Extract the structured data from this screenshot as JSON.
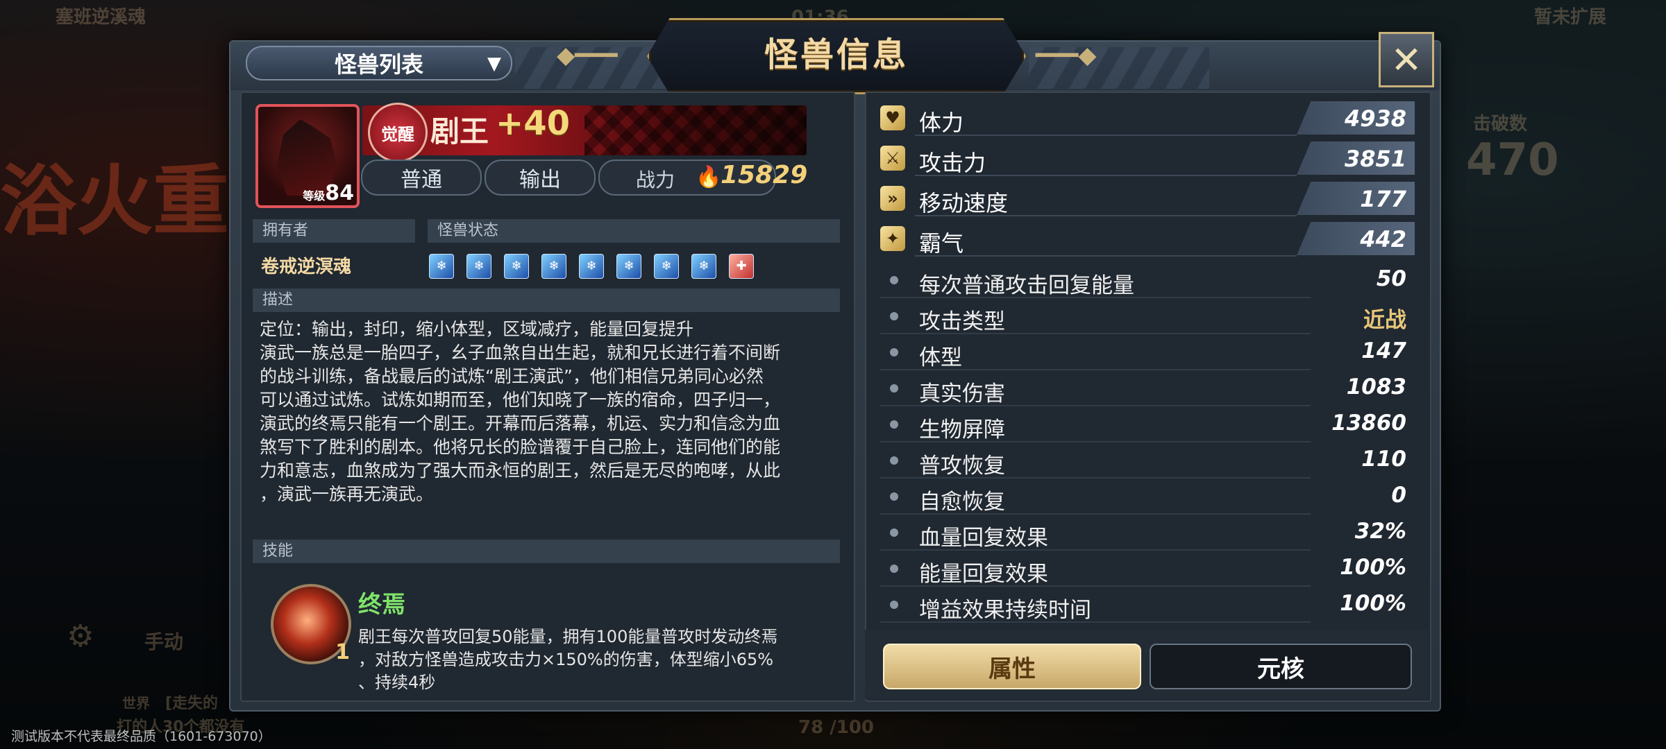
{
  "background": {
    "top_left_label": "塞班逆溪魂",
    "top_center": "01:36",
    "top_right_label": "暂未扩展",
    "left_banner": "浴火重",
    "right_badge_label": "击破数",
    "right_badge_value": "470",
    "bottom_left_setting": "手动",
    "bottom_chat_tag": "世界",
    "bottom_chat_line1": "[走失的",
    "bottom_chat_line2": "打的人30个都没有",
    "bottom_counter": "78 /100",
    "watermark": "测试版本不代表最终品质（1601-673070）"
  },
  "modal": {
    "title": "怪兽信息",
    "dropdown_label": "怪兽列表",
    "dropdown_caret": "▼",
    "close_icon": "✕"
  },
  "monster": {
    "level_label": "等级",
    "level": "84",
    "awaken_badge": "觉醒",
    "name": "剧王",
    "plus_level": "+40",
    "tags": [
      "普通",
      "输出"
    ],
    "power_label": "战力",
    "power_value": "15829"
  },
  "owner": {
    "section_label": "拥有者",
    "name": "卷戒逆溟魂"
  },
  "status": {
    "section_label": "怪兽状态",
    "icons": [
      "frost-icon",
      "frost-icon",
      "frost-icon",
      "frost-icon",
      "frost-icon",
      "frost-icon",
      "frost-icon",
      "frost-icon",
      "heal-icon"
    ]
  },
  "description": {
    "section_label": "描述",
    "role_line": "定位：输出，封印，缩小体型，区域减疗，能量回复提升",
    "lines": [
      "演武一族总是一胎四子，幺子血煞自出生起，就和兄长进行着不间断",
      "的战斗训练，备战最后的试炼“剧王演武”，他们相信兄弟同心必然",
      "可以通过试炼。试炼如期而至，他们知晓了一族的宿命，四子归一，",
      "演武的终焉只能有一个剧王。开幕而后落幕，机运、实力和信念为血",
      "煞写下了胜利的剧本。他将兄长的脸谱覆于自己脸上，连同他们的能",
      "力和意志，血煞成为了强大而永恒的剧王，然后是无尽的咆哮，从此",
      "，演武一族再无演武。"
    ]
  },
  "skill": {
    "section_label": "技能",
    "level": "1",
    "name": "终焉",
    "desc_lines": [
      "剧王每次普攻回复50能量，拥有100能量普攻时发动终焉",
      "，对敌方怪兽造成攻击力×150%的伤害，体型缩小65%",
      "、持续4秒"
    ]
  },
  "main_stats": [
    {
      "icon": "heart-icon",
      "glyph": "♥",
      "label": "体力",
      "value": "4938"
    },
    {
      "icon": "sword-icon",
      "glyph": "⚔",
      "label": "攻击力",
      "value": "3851"
    },
    {
      "icon": "speed-icon",
      "glyph": "»",
      "label": "移动速度",
      "value": "177"
    },
    {
      "icon": "claw-icon",
      "glyph": "✦",
      "label": "霸气",
      "value": "442"
    }
  ],
  "sub_stats": [
    {
      "label": "每次普通攻击回复能量",
      "value": "50"
    },
    {
      "label": "攻击类型",
      "value": "近战"
    },
    {
      "label": "体型",
      "value": "147"
    },
    {
      "label": "真实伤害",
      "value": "1083"
    },
    {
      "label": "生物屏障",
      "value": "13860"
    },
    {
      "label": "普攻恢复",
      "value": "110"
    },
    {
      "label": "自愈恢复",
      "value": "0"
    },
    {
      "label": "血量回复效果",
      "value": "32%"
    },
    {
      "label": "能量回复效果",
      "value": "100%"
    },
    {
      "label": "增益效果持续时间",
      "value": "100%"
    }
  ],
  "tabs": {
    "attributes": "属性",
    "core": "元核"
  },
  "colors": {
    "accent_gold": "#f3d9a4",
    "skill_green": "#7fe36a",
    "awaken_red": "#a3181f"
  }
}
